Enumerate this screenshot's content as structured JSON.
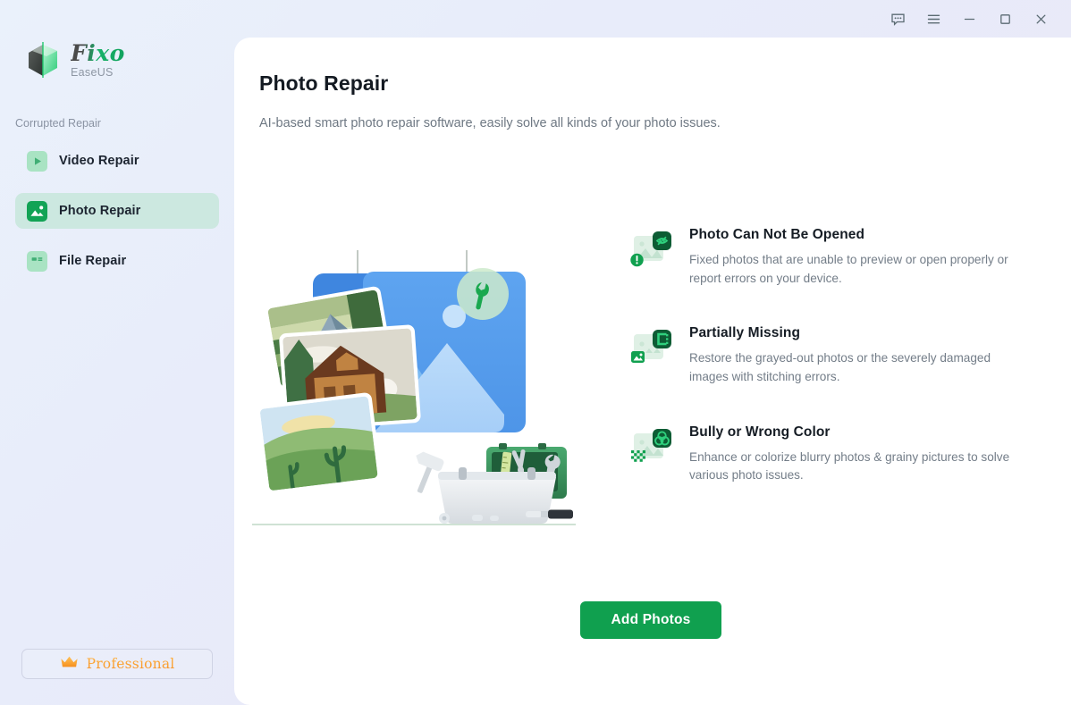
{
  "window": {
    "controls": [
      {
        "name": "feedback-icon",
        "label": "Feedback"
      },
      {
        "name": "menu-icon",
        "label": "Menu"
      },
      {
        "name": "minimize-icon",
        "label": "Minimize"
      },
      {
        "name": "maximize-icon",
        "label": "Maximize"
      },
      {
        "name": "close-icon",
        "label": "Close"
      }
    ]
  },
  "sidebar": {
    "logo": {
      "title": "Fixo",
      "subtitle": "EaseUS",
      "icon": "fixo-logo-icon"
    },
    "section_label": "Corrupted Repair",
    "items": [
      {
        "label": "Video Repair",
        "icon": "video-repair-icon",
        "active": false
      },
      {
        "label": "Photo Repair",
        "icon": "photo-repair-icon",
        "active": true
      },
      {
        "label": "File Repair",
        "icon": "file-repair-icon",
        "active": false
      }
    ],
    "pro_button": {
      "label": "Professional",
      "icon": "crown-icon"
    }
  },
  "main": {
    "title": "Photo Repair",
    "subtitle": "AI-based smart photo repair software, easily solve all kinds of your photo issues.",
    "illustration": "photo-repair-illustration",
    "features": [
      {
        "title": "Photo Can Not Be Opened",
        "desc": "Fixed photos that are unable to preview or open properly or report errors on your device.",
        "icon": "photo-hidden-eye-icon"
      },
      {
        "title": "Partially Missing",
        "desc": "Restore the grayed-out photos or the severely damaged images with stitching errors.",
        "icon": "photo-partial-crop-icon"
      },
      {
        "title": "Bully or Wrong Color",
        "desc": "Enhance or colorize blurry photos & grainy pictures to solve various photo issues.",
        "icon": "photo-color-wheel-icon"
      }
    ],
    "cta": {
      "label": "Add Photos"
    }
  },
  "colors": {
    "accent_green": "#10a04f",
    "dark_green": "#0d5c34",
    "sidebar_active": "#b2e2c8",
    "pro_orange": "#f79023",
    "illustration_blue": "#4a90e8"
  }
}
